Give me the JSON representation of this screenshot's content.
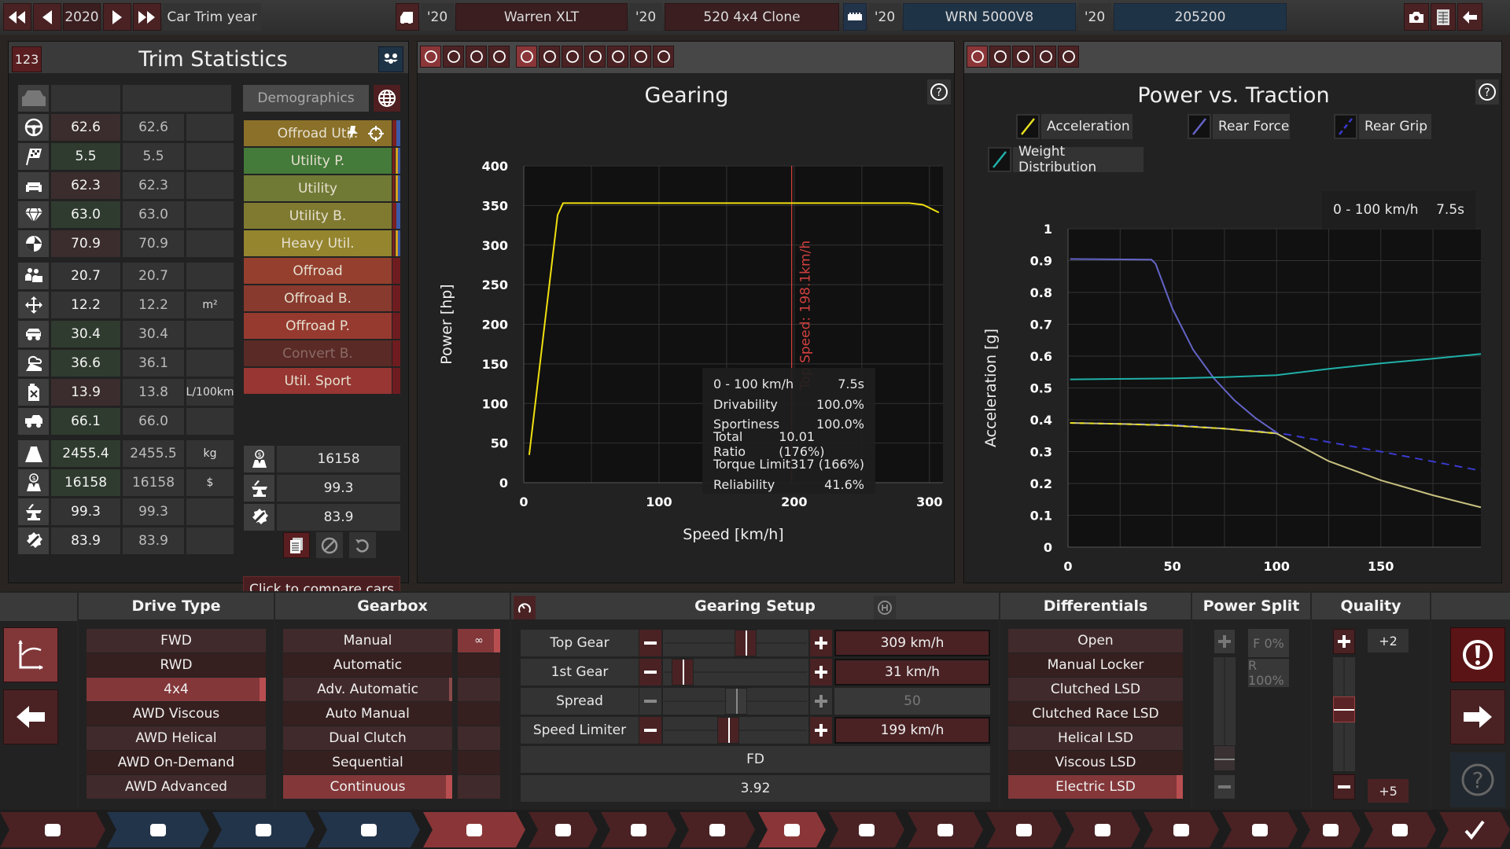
{
  "topbar": {
    "year": "2020",
    "year_label": "Car Trim year",
    "model_year": "'20",
    "model_name": "Warren XLT",
    "trim_year": "'20",
    "trim_name": "520 4x4 Clone",
    "engine_year": "'20",
    "engine_name": "WRN 5000V8",
    "variant_year": "'20",
    "variant_name": "205200"
  },
  "trim_stats": {
    "badge": "123",
    "title": "Trim Statistics",
    "demographics_label": "Demographics",
    "rows": [
      {
        "icon": "steering-wheel-icon",
        "value": "62.6",
        "compare": "62.6",
        "unit": "",
        "state": "bad"
      },
      {
        "icon": "checkered-flag-icon",
        "value": "5.5",
        "compare": "5.5",
        "unit": "",
        "state": "good"
      },
      {
        "icon": "seat-comfort-icon",
        "value": "62.3",
        "compare": "62.3",
        "unit": "",
        "state": "bad"
      },
      {
        "icon": "diamond-icon",
        "value": "63.0",
        "compare": "63.0",
        "unit": "",
        "state": "good"
      },
      {
        "icon": "safety-icon",
        "value": "70.9",
        "compare": "70.9",
        "unit": "",
        "state": "bad"
      },
      {
        "icon": "passengers-icon",
        "value": "20.7",
        "compare": "20.7",
        "unit": "",
        "state": ""
      },
      {
        "icon": "cargo-space-icon",
        "value": "12.2",
        "compare": "12.2",
        "unit": "m²",
        "state": ""
      },
      {
        "icon": "offroad-icon",
        "value": "30.4",
        "compare": "30.4",
        "unit": "",
        "state": "good"
      },
      {
        "icon": "environmental-icon",
        "value": "36.6",
        "compare": "36.1",
        "unit": "",
        "state": "good"
      },
      {
        "icon": "fuel-can-icon",
        "value": "13.9",
        "compare": "13.8",
        "unit": "L/100km",
        "state": "bad"
      },
      {
        "icon": "utility-truck-icon",
        "value": "66.1",
        "compare": "66.0",
        "unit": "",
        "state": "good"
      },
      {
        "icon": "weight-icon",
        "value": "2455.4",
        "compare": "2455.5",
        "unit": "kg",
        "state": "good"
      },
      {
        "icon": "cost-icon",
        "value": "16158",
        "compare": "16158",
        "unit": "$",
        "state": "good"
      },
      {
        "icon": "anvil-icon",
        "value": "99.3",
        "compare": "99.3",
        "unit": "",
        "state": ""
      },
      {
        "icon": "service-icon",
        "value": "83.9",
        "compare": "83.9",
        "unit": "",
        "state": ""
      }
    ],
    "demographics": [
      {
        "label": "Offroad Util.",
        "color": "#8a7028",
        "flags": [
          "#7a2020",
          "#3a5aa8"
        ],
        "pinned": true
      },
      {
        "label": "Utility P.",
        "color": "#447a3a",
        "flags": [
          "#7a2020",
          "#d4a020",
          "#3a5aa8"
        ]
      },
      {
        "label": "Utility",
        "color": "#717a35",
        "flags": [
          "#7a2020",
          "#d4a020",
          "#3a5aa8"
        ]
      },
      {
        "label": "Utility B.",
        "color": "#7f7a30",
        "flags": [
          "#7a2020",
          "#3a5aa8"
        ]
      },
      {
        "label": "Heavy Util.",
        "color": "#94852e",
        "flags": [
          "#7a2020",
          "#d4a020",
          "#3a5aa8"
        ]
      },
      {
        "label": "Offroad",
        "color": "#953f2e",
        "flags": [
          "#6e1c20"
        ]
      },
      {
        "label": "Offroad B.",
        "color": "#883a2e",
        "flags": [
          "#6e1c20"
        ]
      },
      {
        "label": "Offroad P.",
        "color": "#963a30",
        "flags": [
          "#6e1c20"
        ]
      },
      {
        "label": "Convert B.",
        "color": "#5a2a26",
        "flags": [
          "#6e1c20"
        ],
        "dim": true
      },
      {
        "label": "Util. Sport",
        "color": "#973632",
        "flags": [
          "#6e1c20"
        ]
      }
    ],
    "summary": [
      {
        "icon": "cost-icon",
        "value": "16158"
      },
      {
        "icon": "anvil-icon",
        "value": "99.3"
      },
      {
        "icon": "service-icon",
        "value": "83.9"
      }
    ],
    "compare_label": "Click to compare cars"
  },
  "gearing": {
    "title": "Gearing",
    "info": [
      {
        "label": "0 - 100 km/h",
        "value": "7.5s"
      },
      {
        "label": "Drivability",
        "value": "100.0%"
      },
      {
        "label": "Sportiness",
        "value": "100.0%"
      },
      {
        "label": "Total Ratio",
        "value": "10.01 (176%)"
      },
      {
        "label": "Torque Limit",
        "value": "317 (166%)"
      },
      {
        "label": "Reliability",
        "value": "41.6%"
      }
    ],
    "top_speed_label": "Top Speed: 198.1km/h"
  },
  "traction": {
    "title": "Power vs. Traction",
    "legend": [
      {
        "label": "Acceleration",
        "color": "#e8e020"
      },
      {
        "label": "Rear Force",
        "color": "#6464c8"
      },
      {
        "label": "Rear Grip",
        "color": "#3a3ad0",
        "dashed": true
      },
      {
        "label": "Weight Distribution",
        "color": "#20b0a8"
      }
    ],
    "info_label": "0 - 100 km/h",
    "info_value": "7.5s"
  },
  "chart_data": [
    {
      "type": "line",
      "title": "Gearing",
      "xlabel": "Speed [km/h]",
      "ylabel": "Power [hp]",
      "xlim": [
        0,
        310
      ],
      "ylim": [
        0,
        400
      ],
      "xticks": [
        0,
        100,
        200,
        300
      ],
      "yticks": [
        0,
        50,
        100,
        150,
        200,
        250,
        300,
        350,
        400
      ],
      "grid": true,
      "series": [
        {
          "name": "Power",
          "color": "#f0e010",
          "x": [
            4,
            25,
            29,
            100,
            200,
            285,
            295,
            300,
            307
          ],
          "y": [
            35,
            338,
            353,
            353,
            353,
            353,
            351,
            347,
            341
          ]
        }
      ],
      "annotations": [
        {
          "type": "vline",
          "x": 198.1,
          "label": "Top Speed: 198.1km/h",
          "color": "#d04040"
        }
      ]
    },
    {
      "type": "line",
      "title": "Power vs. Traction",
      "xlabel": "Speed [km/h]",
      "ylabel": "Acceleration [g]",
      "xlim": [
        0,
        198
      ],
      "ylim": [
        0,
        1
      ],
      "xticks": [
        0,
        50,
        100,
        150
      ],
      "yticks": [
        0,
        0.1,
        0.2,
        0.3,
        0.4,
        0.5,
        0.6,
        0.7,
        0.8,
        0.9,
        1
      ],
      "grid": true,
      "legend_position": "top",
      "series": [
        {
          "name": "Rear Force",
          "color": "#6464c8",
          "x": [
            1,
            40,
            42,
            50,
            60,
            70,
            80,
            90,
            100
          ],
          "y": [
            0.905,
            0.903,
            0.89,
            0.75,
            0.62,
            0.53,
            0.46,
            0.405,
            0.36
          ]
        },
        {
          "name": "Rear Grip",
          "color": "#3a3ad0",
          "dashed": true,
          "x": [
            1,
            50,
            100,
            150,
            198
          ],
          "y": [
            0.39,
            0.385,
            0.36,
            0.3,
            0.24
          ]
        },
        {
          "name": "Acceleration",
          "color": "#c8c080",
          "x": [
            1,
            25,
            50,
            75,
            100,
            125,
            150,
            175,
            198
          ],
          "y": [
            0.39,
            0.387,
            0.382,
            0.372,
            0.357,
            0.27,
            0.21,
            0.163,
            0.125
          ]
        },
        {
          "name": "Weight Distribution",
          "color": "#20b0a8",
          "x": [
            1,
            50,
            75,
            100,
            125,
            150,
            175,
            198
          ],
          "y": [
            0.527,
            0.53,
            0.534,
            0.54,
            0.56,
            0.577,
            0.592,
            0.607
          ]
        }
      ]
    }
  ],
  "drive_type": {
    "title": "Drive Type",
    "items": [
      "FWD",
      "RWD",
      "4x4",
      "AWD Viscous",
      "AWD Helical",
      "AWD On-Demand",
      "AWD Advanced"
    ],
    "selected": 2
  },
  "gearbox": {
    "title": "Gearbox",
    "items": [
      "Manual",
      "Automatic",
      "Adv. Automatic",
      "Auto Manual",
      "Dual Clutch",
      "Sequential",
      "Continuous"
    ],
    "selected": 6,
    "gear_count": "∞"
  },
  "gearing_setup": {
    "title": "Gearing Setup",
    "rows": [
      {
        "label": "Top Gear",
        "value": "309 km/h",
        "position": 0.58,
        "enabled": true
      },
      {
        "label": "1st Gear",
        "value": "31 km/h",
        "position": 0.07,
        "enabled": true
      },
      {
        "label": "Spread",
        "value": "50",
        "position": 0.5,
        "enabled": false
      },
      {
        "label": "Speed Limiter",
        "value": "199 km/h",
        "position": 0.44,
        "enabled": true
      }
    ],
    "fd_label": "FD",
    "fd_value": "3.92"
  },
  "differentials": {
    "title": "Differentials",
    "items": [
      "Open",
      "Manual Locker",
      "Clutched LSD",
      "Clutched Race LSD",
      "Helical LSD",
      "Viscous LSD",
      "Electric LSD"
    ],
    "selected": 6
  },
  "power_split": {
    "title": "Power Split",
    "front": "F 0%",
    "rear": "R 100%"
  },
  "quality": {
    "title": "Quality",
    "max": "+2",
    "current": "+5",
    "level": 0.55
  }
}
